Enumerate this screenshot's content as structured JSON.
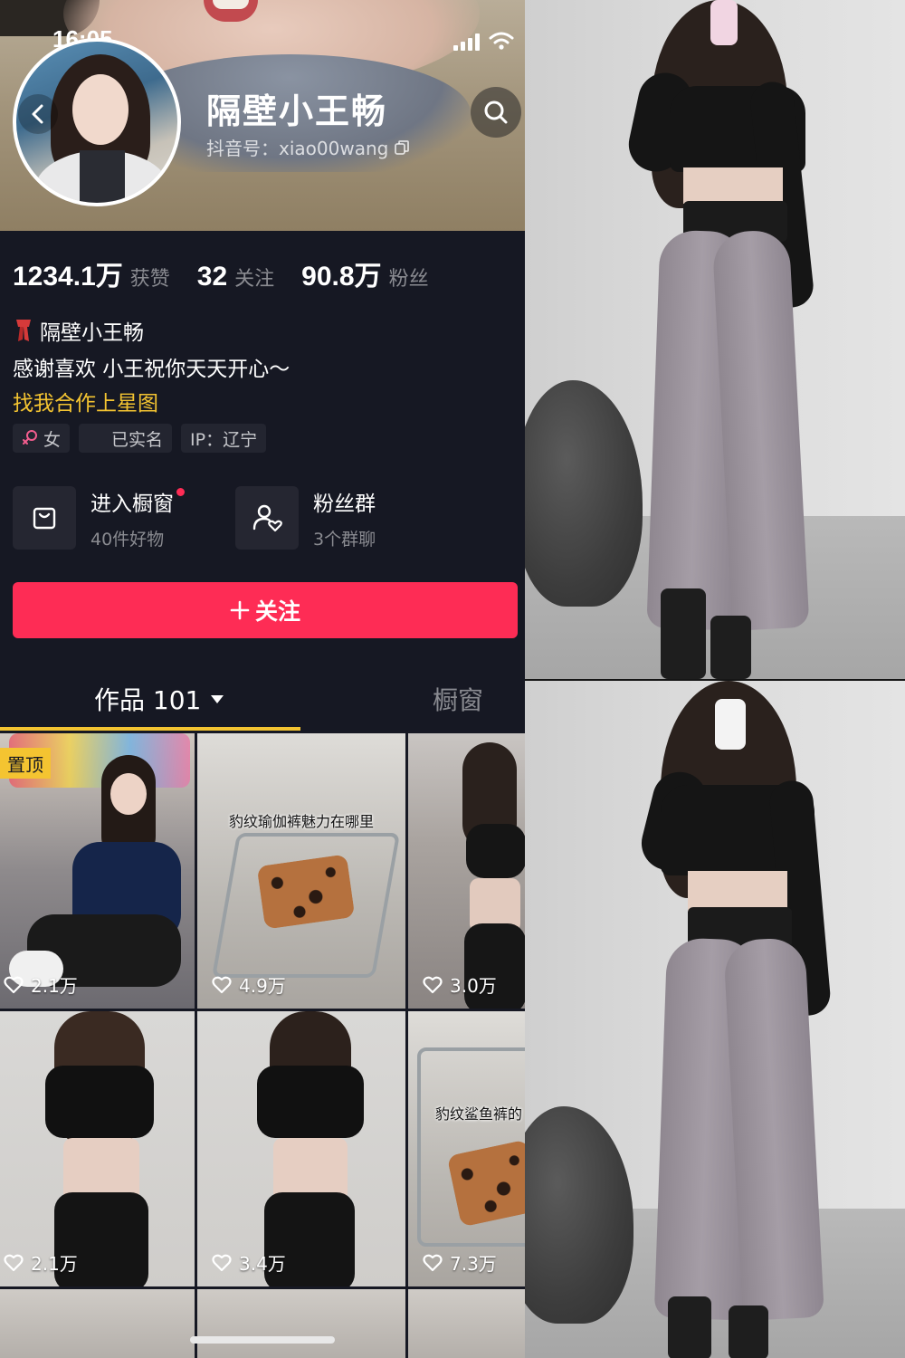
{
  "status": {
    "time": "16:05"
  },
  "profile": {
    "name": "隔壁小王畅",
    "douyin_id": "抖音号：xiao00wang",
    "stats": [
      {
        "num": "1234.1万",
        "label": "获赞"
      },
      {
        "num": "32",
        "label": "关注"
      },
      {
        "num": "90.8万",
        "label": "粉丝"
      }
    ],
    "bio_line1": "隔壁小王畅",
    "bio_line2": "感谢喜欢 小王祝你天天开心～",
    "bio_line3": "找我合作上星图",
    "tags": {
      "gender": "女",
      "verified": "已实名",
      "ip": "IP：辽宁"
    }
  },
  "entries": {
    "shop": {
      "title": "进入橱窗",
      "sub": "40件好物"
    },
    "fans": {
      "title": "粉丝群",
      "sub": "3个群聊"
    }
  },
  "follow_label": "关注",
  "tabs": {
    "works": "作品 101",
    "shop": "橱窗"
  },
  "videos": [
    {
      "likes": "2.1万",
      "pinned_label": "置顶"
    },
    {
      "likes": "4.9万",
      "caption": "豹纹瑜伽裤魅力在哪里"
    },
    {
      "likes": "3.0万"
    },
    {
      "likes": "2.1万"
    },
    {
      "likes": "3.4万"
    },
    {
      "likes": "7.3万",
      "caption": "豹纹鲨鱼裤的"
    }
  ],
  "colors": {
    "accent": "#fe2c55",
    "highlight": "#f4c431",
    "background": "#161823"
  }
}
